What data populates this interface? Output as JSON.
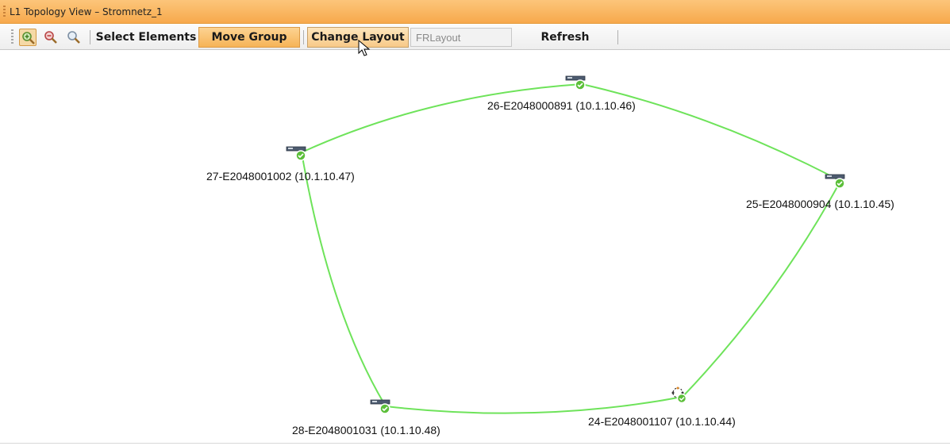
{
  "window": {
    "title": "L1 Topology View – Stromnetz_1"
  },
  "toolbar": {
    "zoom_buttons": [
      {
        "icon": "zoom-in-icon",
        "active": true
      },
      {
        "icon": "zoom-out-icon",
        "active": false
      },
      {
        "icon": "zoom-reset-icon",
        "active": false
      }
    ],
    "select_elements_label": "Select Elements",
    "move_group_label": "Move Group",
    "change_layout_label": "Change Layout",
    "layout_value": "FRLayout",
    "refresh_label": "Refresh"
  },
  "topology": {
    "link_color": "#6ee35a",
    "status_color": "#5cbf3a",
    "nodes": [
      {
        "label": "26-E2048000891 (10.1.10.46)",
        "icon": "network-switch-icon",
        "status": "ok"
      },
      {
        "label": "27-E2048001002 (10.1.10.47)",
        "icon": "network-switch-icon",
        "status": "ok"
      },
      {
        "label": "25-E2048000904 (10.1.10.45)",
        "icon": "network-switch-icon",
        "status": "ok"
      },
      {
        "label": "28-E2048001031 (10.1.10.48)",
        "icon": "network-switch-icon",
        "status": "ok"
      },
      {
        "label": "24-E2048001107 (10.1.10.44)",
        "icon": "network-node-selected-icon",
        "status": "ok"
      }
    ]
  }
}
